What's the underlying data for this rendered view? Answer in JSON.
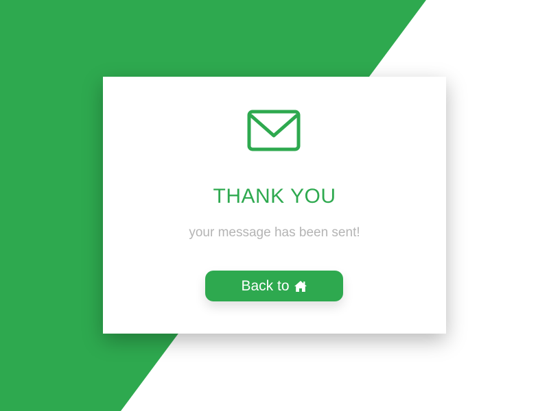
{
  "colors": {
    "brand": "#2ea94f",
    "background": "#ffffff",
    "card": "#ffffff",
    "muted_text": "#b4b4b4"
  },
  "icons": {
    "header": "mail-icon",
    "button": "home-icon"
  },
  "card": {
    "title": "THANK YOU",
    "message": "your message has been sent!",
    "button_label": "Back to"
  }
}
